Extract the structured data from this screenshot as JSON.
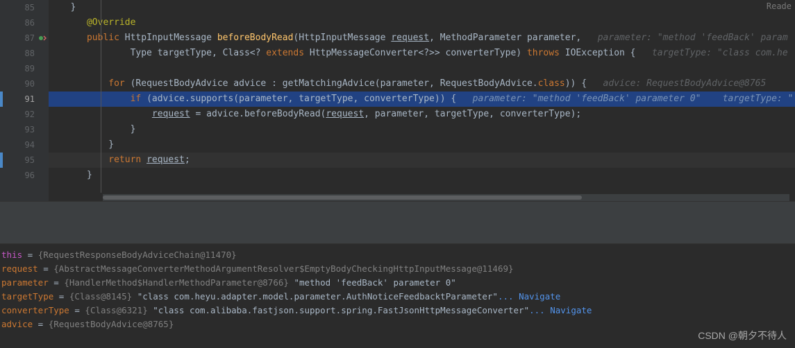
{
  "right_label": "Reade",
  "lines": {
    "l85": {
      "num": "85"
    },
    "l86": {
      "num": "86",
      "annotation": "@Override"
    },
    "l87": {
      "num": "87",
      "t1": "public ",
      "t2": "HttpInputMessage ",
      "t3": "beforeBodyRead",
      "t4": "(HttpInputMessage ",
      "t5": "request",
      "t6": ", MethodParameter parameter,   ",
      "hint": "parameter: \"method 'feedBack' param"
    },
    "l88": {
      "num": "88",
      "t1": "Type targetType, Class<? ",
      "t2": "extends ",
      "t3": "HttpMessageConverter<?>> converterType) ",
      "t4": "throws ",
      "t5": "IOException {   ",
      "hint": "targetType: \"class com.he"
    },
    "l89": {
      "num": "89"
    },
    "l90": {
      "num": "90",
      "t1": "for ",
      "t2": "(RequestBodyAdvice advice : getMatchingAdvice(parameter, RequestBodyAdvice.",
      "t3": "class",
      "t4": ")) {   ",
      "hint": "advice: RequestBodyAdvice@8765"
    },
    "l91": {
      "num": "91",
      "t1": "if ",
      "t2": "(advice.supports(parameter, targetType, converterType)) {   ",
      "h1": "parameter: \"method 'feedBack' parameter 0\"    ",
      "h2": "targetType: \""
    },
    "l92": {
      "num": "92",
      "t1": "request",
      "t2": " = advice.beforeBodyRead(",
      "t3": "request",
      "t4": ", parameter, targetType, converterType);"
    },
    "l93": {
      "num": "93",
      "t1": "}"
    },
    "l94": {
      "num": "94",
      "t1": "}"
    },
    "l95": {
      "num": "95",
      "t1": "return ",
      "t2": "request",
      "t3": ";"
    },
    "l96": {
      "num": "96",
      "t1": "}"
    }
  },
  "debug": {
    "this": {
      "label": "this",
      "eq": " = ",
      "val": "{RequestResponseBodyAdviceChain@11470}"
    },
    "request": {
      "label": "request",
      "eq": " = ",
      "val": "{AbstractMessageConverterMethodArgumentResolver$EmptyBodyCheckingHttpInputMessage@11469}"
    },
    "parameter": {
      "label": "parameter",
      "eq": " = ",
      "val1": "{HandlerMethod$HandlerMethodParameter@8766} ",
      "str": "\"method 'feedBack' parameter 0\""
    },
    "targetType": {
      "label": "targetType",
      "eq": " = ",
      "val1": "{Class@8145} ",
      "str": "\"class com.heyu.adapter.model.parameter.AuthNoticeFeedbacktParameter\"",
      "nav": "... Navigate"
    },
    "converterType": {
      "label": "converterType",
      "eq": " = ",
      "val1": "{Class@6321} ",
      "str": "\"class com.alibaba.fastjson.support.spring.FastJsonHttpMessageConverter\"",
      "nav": "... Navigate"
    },
    "advice": {
      "label": "advice",
      "eq": " = ",
      "val": "{RequestBodyAdvice@8765}"
    }
  },
  "watermark": "CSDN @朝夕不待人"
}
